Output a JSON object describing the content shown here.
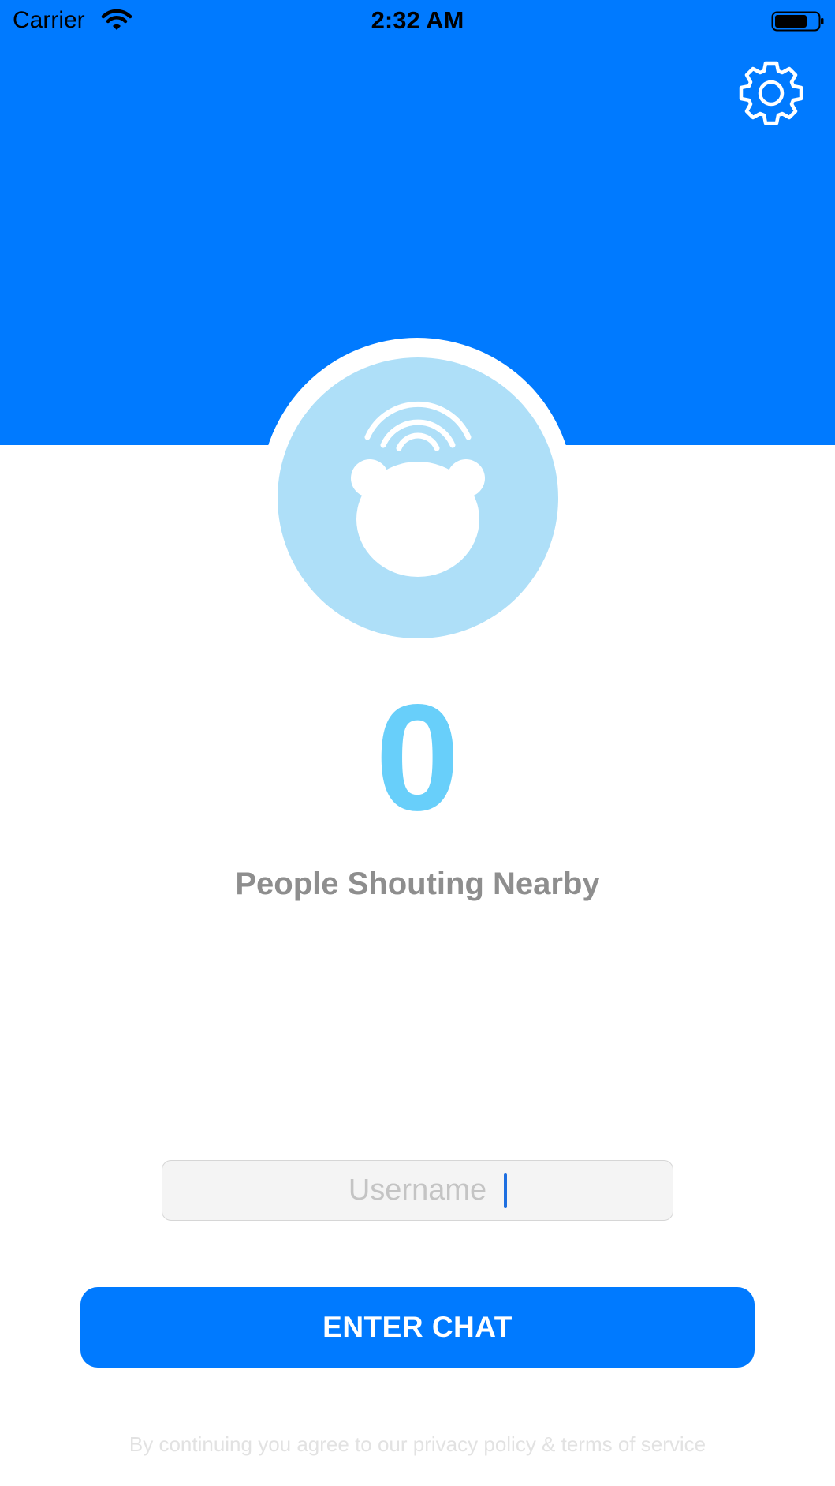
{
  "status_bar": {
    "carrier": "Carrier",
    "time": "2:32 AM",
    "wifi_icon": "wifi-icon",
    "battery_icon": "battery-icon"
  },
  "header": {
    "settings_icon": "gear-icon",
    "background_color": "#007aff"
  },
  "avatar": {
    "icon": "bear-broadcast-icon",
    "circle_color": "#aedff8"
  },
  "stats": {
    "count": "0",
    "count_color": "#68cffa",
    "label": "People Shouting Nearby"
  },
  "login": {
    "username_placeholder": "Username",
    "username_value": "",
    "enter_label": "ENTER CHAT",
    "accent_color": "#007aff"
  },
  "footer": {
    "legal_text": "By continuing you agree to our privacy policy & terms of service"
  }
}
